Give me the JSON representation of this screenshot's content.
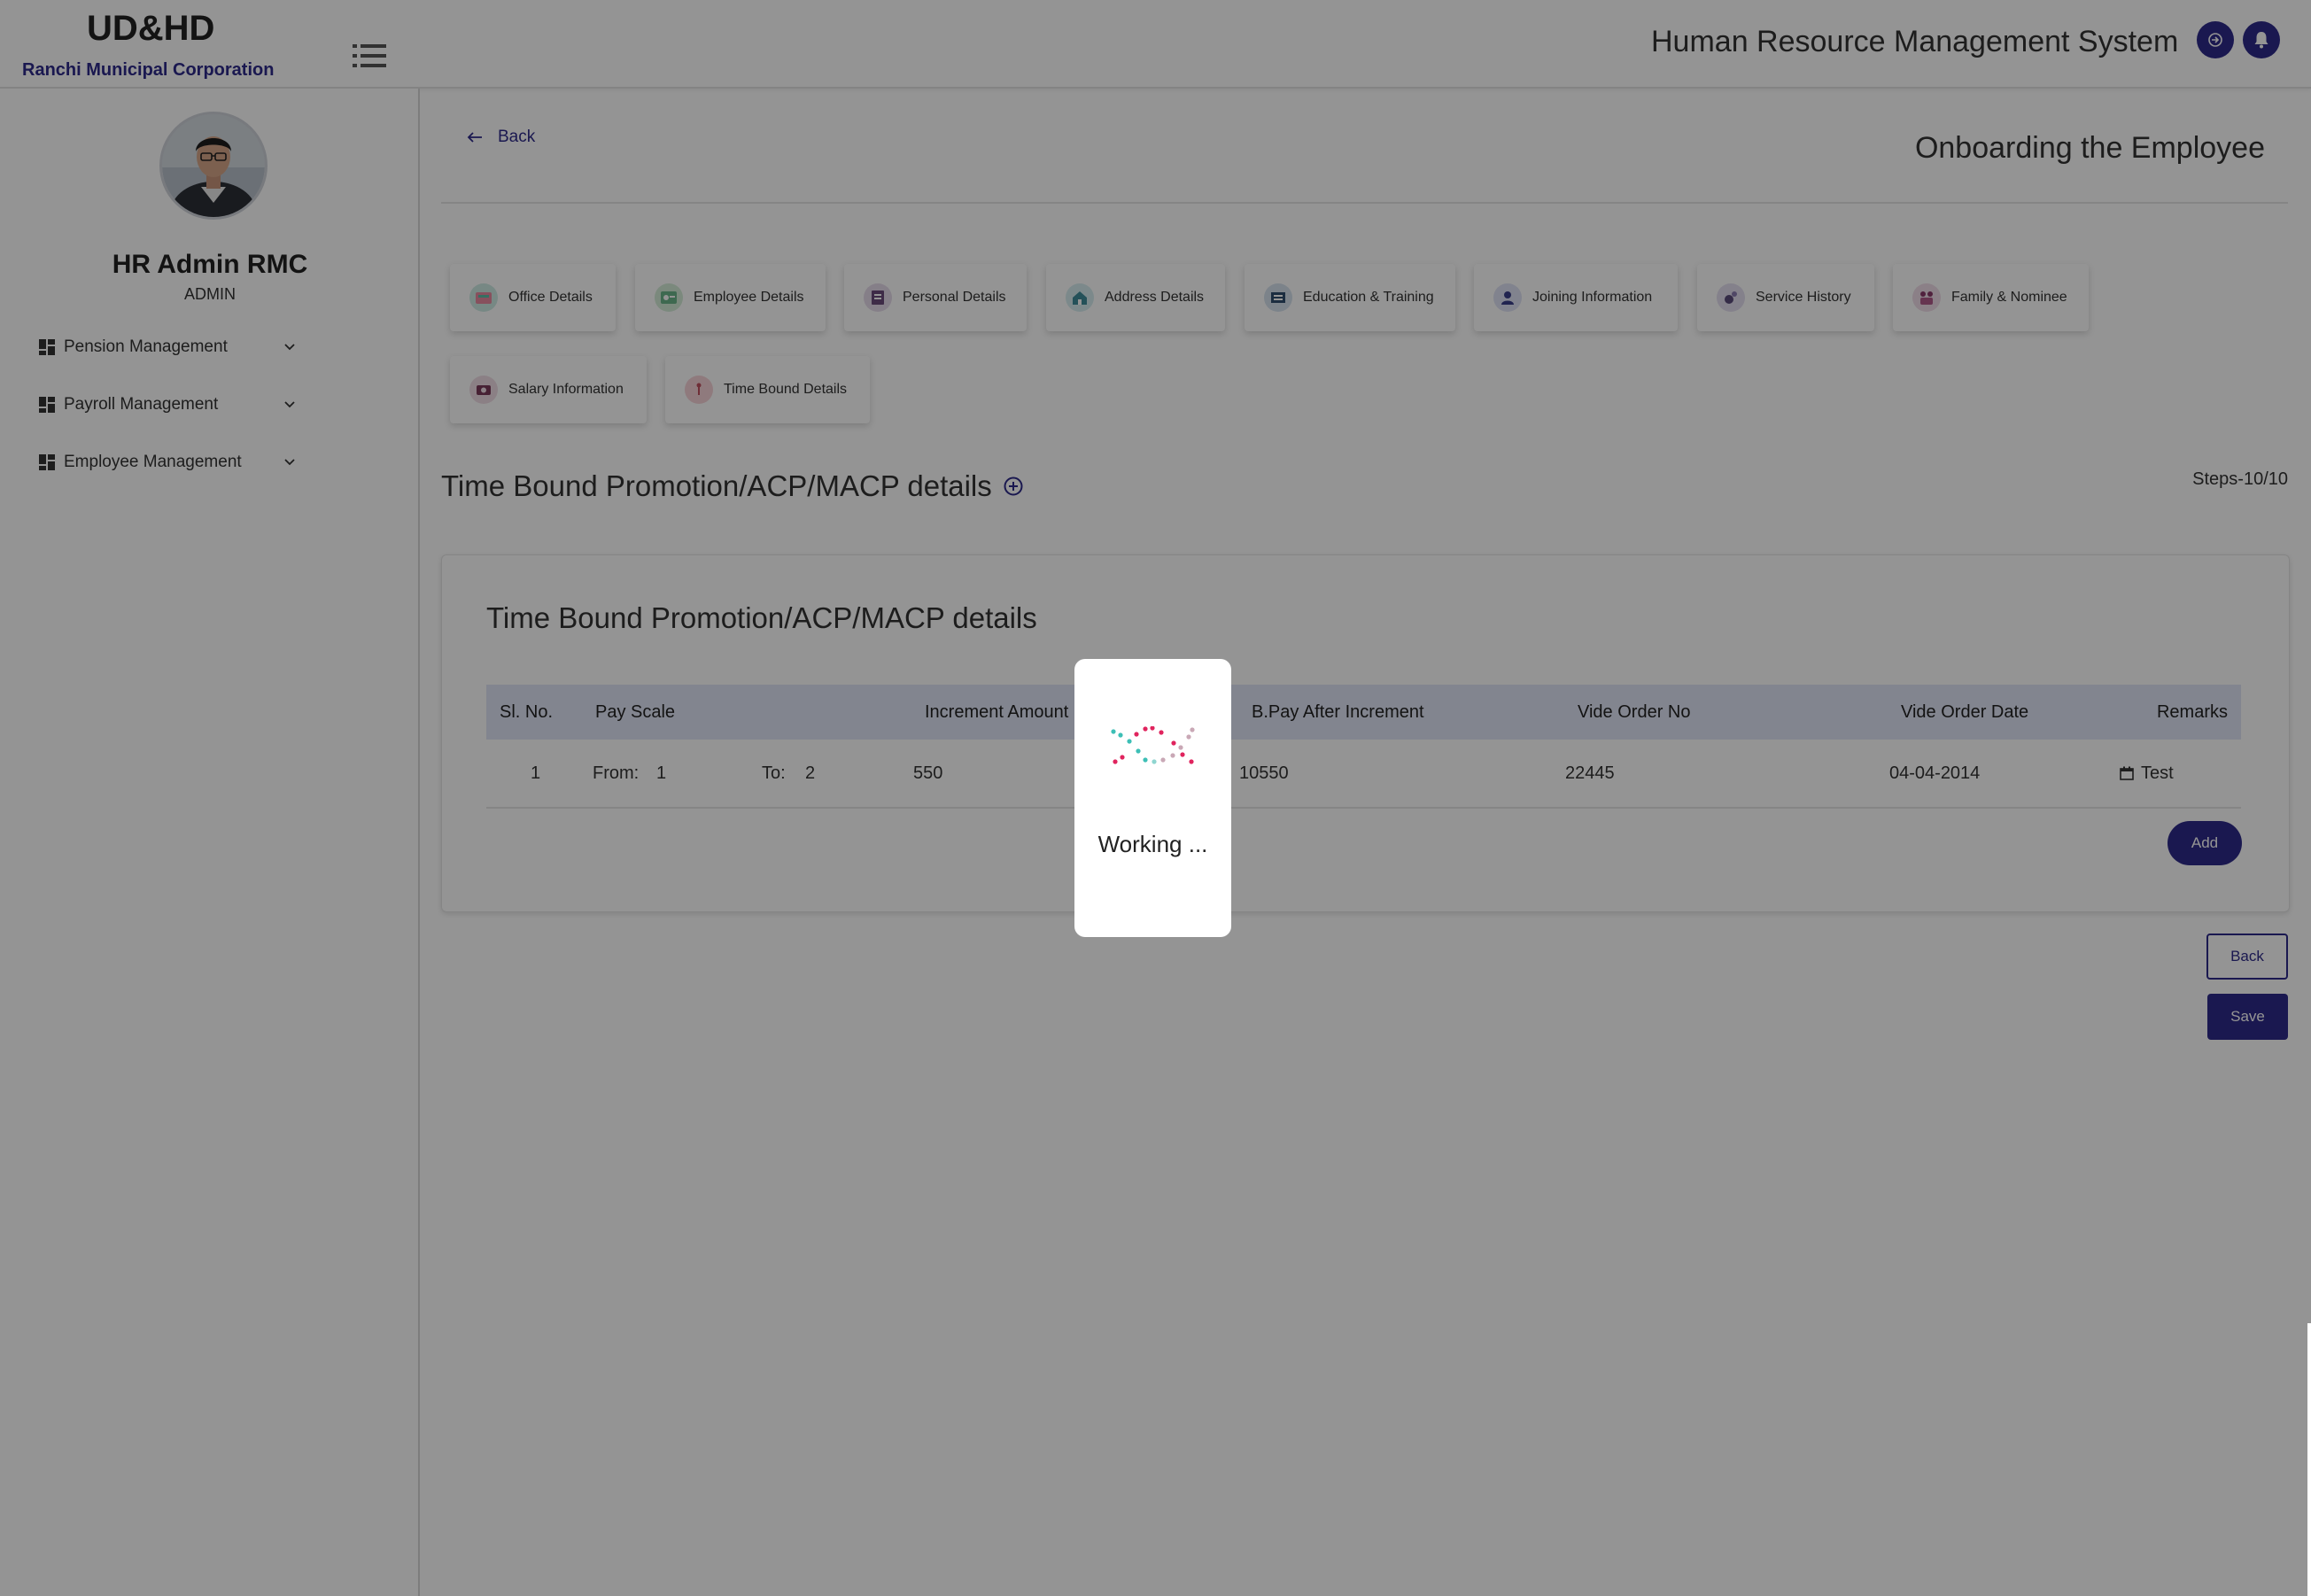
{
  "header": {
    "brand_title": "UD&HD",
    "brand_subtitle": "Ranchi Municipal Corporation",
    "app_title": "Human Resource Management System",
    "menu_icon": "list-menu-icon",
    "logout_icon": "logout-icon",
    "bell_icon": "notification-bell-icon",
    "accent_color": "#2e2a8a"
  },
  "sidebar": {
    "user_name": "HR Admin RMC",
    "user_role": "ADMIN",
    "items": [
      {
        "label": "Pension Management"
      },
      {
        "label": "Payroll Management"
      },
      {
        "label": "Employee Management"
      }
    ]
  },
  "main": {
    "back_link": "Back",
    "page_title": "Onboarding the Employee",
    "tabs": [
      {
        "label": "Office Details",
        "icon": "office-details-icon"
      },
      {
        "label": "Employee Details",
        "icon": "employee-details-icon"
      },
      {
        "label": "Personal Details",
        "icon": "personal-details-icon"
      },
      {
        "label": "Address Details",
        "icon": "address-details-icon"
      },
      {
        "label": "Education & Training",
        "icon": "education-training-icon"
      },
      {
        "label": "Joining Information",
        "icon": "joining-information-icon"
      },
      {
        "label": "Service History",
        "icon": "service-history-icon"
      },
      {
        "label": "Family & Nominee",
        "icon": "family-nominee-icon"
      },
      {
        "label": "Salary Information",
        "icon": "salary-information-icon"
      },
      {
        "label": "Time Bound Details",
        "icon": "time-bound-details-icon"
      }
    ],
    "section_heading": "Time Bound Promotion/ACP/MACP details",
    "steps": "Steps-10/10",
    "card": {
      "title": "Time Bound Promotion/ACP/MACP details",
      "columns": [
        "Sl. No.",
        "Pay Scale",
        "Increment Amount",
        "B.Pay After Increment",
        "Vide Order No",
        "Vide Order Date",
        "Remarks"
      ],
      "row": {
        "sl_no": "1",
        "from_label": "From:",
        "from_value": "1",
        "to_label": "To:",
        "to_value": "2",
        "increment_amount": "550",
        "bpay_after": "10550",
        "vide_order_no": "22445",
        "vide_order_date": "04-04-2014",
        "remarks": "Test"
      },
      "add_button": "Add"
    },
    "back_button": "Back",
    "save_button": "Save"
  },
  "overlay": {
    "loading_text": "Working ..."
  }
}
